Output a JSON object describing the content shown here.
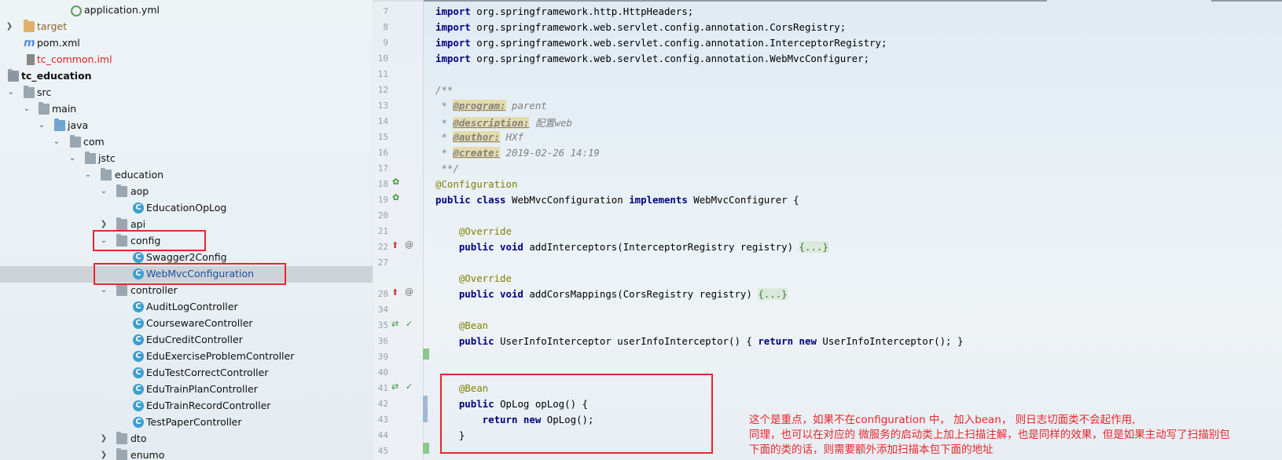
{
  "tree": {
    "items": [
      {
        "label": "application.yml",
        "icon": "yaml-file-icon"
      },
      {
        "label": "target",
        "icon": "folder-icon"
      },
      {
        "label": "pom.xml",
        "icon": "maven-file-icon"
      },
      {
        "label": "tc_common.iml",
        "icon": "iml-file-icon"
      },
      {
        "label": "tc_education",
        "icon": "module-folder-icon"
      },
      {
        "label": "src",
        "icon": "folder-icon"
      },
      {
        "label": "main",
        "icon": "folder-icon"
      },
      {
        "label": "java",
        "icon": "source-folder-icon"
      },
      {
        "label": "com",
        "icon": "package-icon"
      },
      {
        "label": "jstc",
        "icon": "package-icon"
      },
      {
        "label": "education",
        "icon": "package-icon"
      },
      {
        "label": "aop",
        "icon": "package-icon"
      },
      {
        "label": "EducationOpLog",
        "icon": "class-icon"
      },
      {
        "label": "api",
        "icon": "package-icon"
      },
      {
        "label": "config",
        "icon": "package-icon"
      },
      {
        "label": "Swagger2Config",
        "icon": "class-icon"
      },
      {
        "label": "WebMvcConfiguration",
        "icon": "class-icon"
      },
      {
        "label": "controller",
        "icon": "package-icon"
      },
      {
        "label": "AuditLogController",
        "icon": "class-icon"
      },
      {
        "label": "CoursewareController",
        "icon": "class-icon"
      },
      {
        "label": "EduCreditController",
        "icon": "class-icon"
      },
      {
        "label": "EduExerciseProblemController",
        "icon": "class-icon"
      },
      {
        "label": "EduTestCorrectController",
        "icon": "class-icon"
      },
      {
        "label": "EduTrainPlanController",
        "icon": "class-icon"
      },
      {
        "label": "EduTrainRecordController",
        "icon": "class-icon"
      },
      {
        "label": "TestPaperController",
        "icon": "class-icon"
      },
      {
        "label": "dto",
        "icon": "package-icon"
      },
      {
        "label": "enumo",
        "icon": "package-icon"
      }
    ],
    "class_glyph": "C"
  },
  "editor": {
    "line_numbers": [
      "7",
      "8",
      "9",
      "10",
      "11",
      "12",
      "13",
      "14",
      "15",
      "16",
      "17",
      "18",
      "19",
      "20",
      "21",
      "22",
      "27",
      "28",
      "34",
      "35",
      "36",
      "39",
      "40",
      "41",
      "42",
      "43",
      "44",
      "45"
    ],
    "lines": {
      "l7_kw": "import",
      "l7": " org.springframework.http.HttpHeaders;",
      "l8_kw": "import",
      "l8": " org.springframework.web.servlet.config.annotation.CorsRegistry;",
      "l9_kw": "import",
      "l9": " org.springframework.web.servlet.config.annotation.InterceptorRegistry;",
      "l10_kw": "import",
      "l10": " org.springframework.web.servlet.config.annotation.WebMvcConfigurer;",
      "l12": "/**",
      "l13_pre": " * ",
      "l13_tag": "@program:",
      "l13_val": " parent",
      "l14_pre": " * ",
      "l14_tag": "@description:",
      "l14_val": " 配置web",
      "l15_pre": " * ",
      "l15_tag": "@author:",
      "l15_val": " HXf",
      "l16_pre": " * ",
      "l16_tag": "@create:",
      "l16_val": " 2019-02-26 14:19",
      "l17": " **/",
      "l18": "@Configuration",
      "l19_kw1": "public class",
      "l19_a": " WebMvcConfiguration ",
      "l19_kw2": "implements",
      "l19_b": " WebMvcConfigurer {",
      "l21": "    @Override",
      "l22_kw": "    public void",
      "l22_a": " addInterceptors(InterceptorRegistry registry) ",
      "l22_fold": "{...}",
      "l27": "    @Override",
      "l28_kw": "    public void",
      "l28_a": " addCorsMappings(CorsRegistry registry) ",
      "l28_fold": "{...}",
      "l35": "    @Bean",
      "l36_kw": "    public",
      "l36_a": " UserInfoInterceptor userInfoInterceptor() { ",
      "l36_kw2": "return new",
      "l36_b": " UserInfoInterceptor(); }",
      "l41": "    @Bean",
      "l42_kw": "    public",
      "l42_a": " OpLog opLog() {",
      "l43_kw": "        return new",
      "l43_a": " OpLog();",
      "l44": "    }"
    }
  },
  "note": {
    "line1": "这个是重点，如果不在configuration 中， 加入bean， 则日志切面类不会起作用,",
    "line2": "同理，也可以在对应的 微服务的启动类上加上扫描注解，也是同样的效果，但是如果主动写了扫描别包",
    "line3": "下面的类的话，则需要额外添加扫描本包下面的地址"
  },
  "colors": {
    "highlight": "#e8262b",
    "keyword": "#000080",
    "annotation": "#808000",
    "comment": "#808080"
  }
}
